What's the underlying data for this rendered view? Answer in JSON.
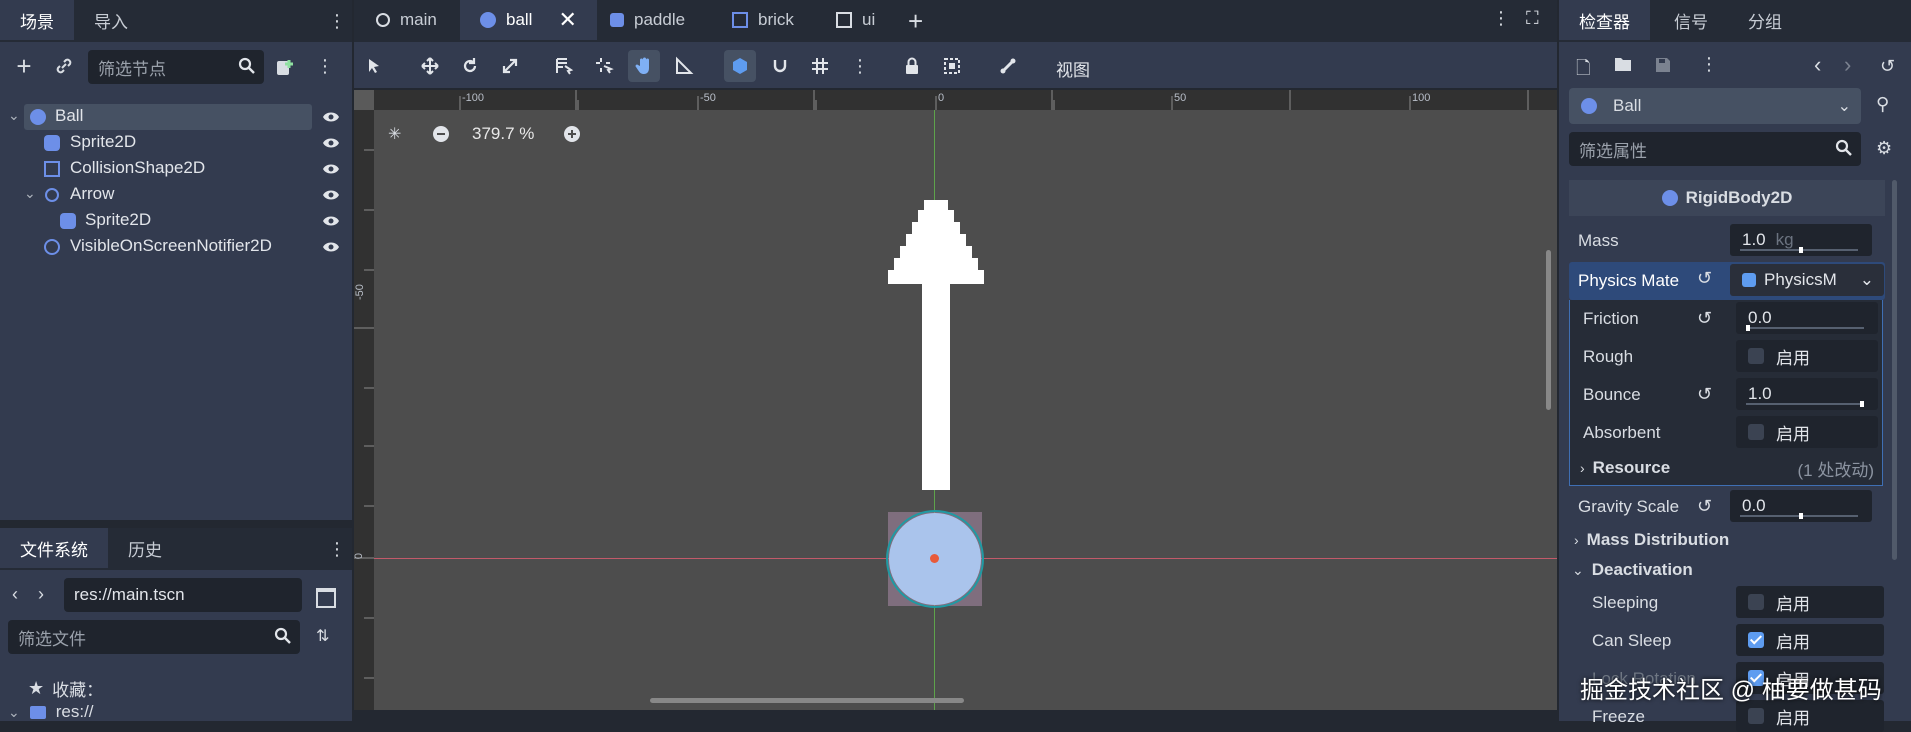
{
  "left_tabs": {
    "scene": "场景",
    "import": "导入"
  },
  "scene_toolbar": {
    "filter_placeholder": "筛选节点"
  },
  "scene_tree": [
    {
      "label": "Ball",
      "icon": "rigidbody-icon",
      "depth": 0
    },
    {
      "label": "Sprite2D",
      "icon": "sprite-icon",
      "depth": 1
    },
    {
      "label": "CollisionShape2D",
      "icon": "collision-icon",
      "depth": 1
    },
    {
      "label": "Arrow",
      "icon": "node2d-icon",
      "depth": 1
    },
    {
      "label": "Sprite2D",
      "icon": "sprite-icon",
      "depth": 2
    },
    {
      "label": "VisibleOnScreenNotifier2D",
      "icon": "notifier-icon",
      "depth": 1
    }
  ],
  "fs_tabs": {
    "filesystem": "文件系统",
    "history": "历史"
  },
  "fs": {
    "path": "res://main.tscn",
    "filter_placeholder": "筛选文件",
    "favorites": "收藏：",
    "root": "res://"
  },
  "editor_tabs": [
    {
      "label": "main"
    },
    {
      "label": "ball"
    },
    {
      "label": "paddle"
    },
    {
      "label": "brick"
    },
    {
      "label": "ui"
    }
  ],
  "viewport": {
    "view_menu": "视图",
    "zoom": "379.7 %",
    "ruler_top": [
      "-100",
      "-50",
      "0",
      "50",
      "100"
    ],
    "ruler_left": [
      "-50",
      "0"
    ]
  },
  "inspector_tabs": {
    "inspector": "检查器",
    "signal": "信号",
    "group": "分组"
  },
  "inspector": {
    "node_name": "Ball",
    "filter_placeholder": "筛选属性",
    "class_name": "RigidBody2D",
    "mass_label": "Mass",
    "mass_value": "1.0",
    "mass_unit": "kg",
    "physics_material_label": "Physics Mate",
    "physics_material_value": "PhysicsM",
    "friction_label": "Friction",
    "friction_value": "0.0",
    "rough_label": "Rough",
    "enable": "启用",
    "bounce_label": "Bounce",
    "bounce_value": "1.0",
    "absorbent_label": "Absorbent",
    "resource_label": "Resource",
    "resource_changes": "(1 处改动)",
    "gravity_label": "Gravity Scale",
    "gravity_value": "0.0",
    "mass_dist_label": "Mass Distribution",
    "deactivation_label": "Deactivation",
    "sleeping_label": "Sleeping",
    "can_sleep_label": "Can Sleep",
    "lock_rotation_label": "Lock Rotation",
    "freeze_label": "Freeze"
  },
  "watermark": "掘金技术社区 @ 柚要做甚码"
}
